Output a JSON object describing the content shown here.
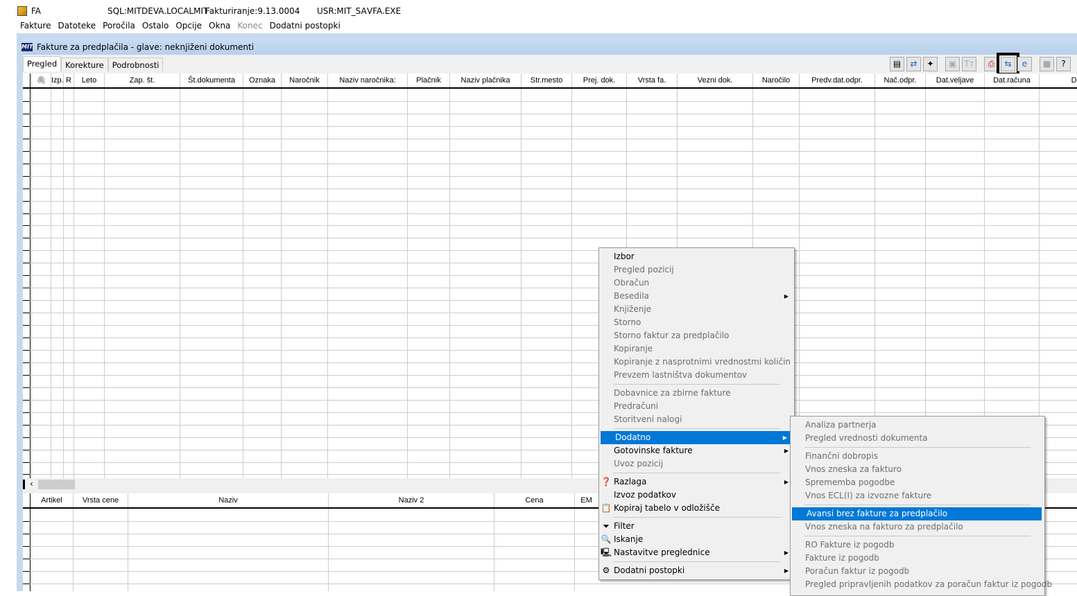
{
  "titlebar": {
    "app": "FA",
    "sql": "SQL:MITDEVA.LOCALMIT",
    "version": "Fakturiranje:9.13.0004",
    "user": "USR:MIT_SA",
    "exe": "VFA.EXE"
  },
  "menubar": [
    {
      "label": "Fakture",
      "enabled": true
    },
    {
      "label": "Datoteke",
      "enabled": true
    },
    {
      "label": "Poročila",
      "enabled": true
    },
    {
      "label": "Ostalo",
      "enabled": true
    },
    {
      "label": "Opcije",
      "enabled": true
    },
    {
      "label": "Okna",
      "enabled": true
    },
    {
      "label": "Konec",
      "enabled": false
    },
    {
      "label": "Dodatni postopki",
      "enabled": true
    }
  ],
  "window": {
    "logo": "MIT",
    "title": "Fakture za predplačila - glave: neknjiženi dokumenti"
  },
  "tabs": [
    {
      "label": "Pregled",
      "active": true
    },
    {
      "label": "Korekture"
    },
    {
      "label": "Podrobnosti"
    }
  ],
  "toolbar": [
    {
      "icon": "document-icon"
    },
    {
      "icon": "refresh-icon"
    },
    {
      "icon": "magic-wand-icon"
    },
    {
      "icon": "bag-icon",
      "disabled": true
    },
    {
      "icon": "font-icon",
      "disabled": true
    },
    {
      "icon": "pdf-icon"
    },
    {
      "icon": "transfer-icon",
      "highlighted": true
    },
    {
      "icon": "internet-explorer-icon"
    },
    {
      "icon": "gray-square-icon",
      "disabled": true
    },
    {
      "icon": "help-icon"
    }
  ],
  "main_grid": {
    "columns": [
      "",
      "Izp.",
      "R",
      "Leto",
      "Zap. št.",
      "Št.dokumenta",
      "Oznaka",
      "Naročnik",
      "Naziv naročnika:",
      "Plačnik",
      "Naziv plačnika",
      "Str.mesto",
      "Prej. dok.",
      "Vrsta fa.",
      "Vezni dok.",
      "Naročilo",
      "Predv.dat.odpr.",
      "Nač.odpr.",
      "Dat.veljave",
      "Dat.računa",
      "Davčni d"
    ]
  },
  "detail_grid": {
    "columns": [
      "Artikel",
      "Vrsta cene",
      "Naziv",
      "Naziv 2",
      "Cena",
      "EM"
    ]
  },
  "context_menu": {
    "items": [
      {
        "label": "Izbor",
        "enabled": true
      },
      {
        "label": "Pregled pozicij"
      },
      {
        "label": "Obračun"
      },
      {
        "label": "Besedila",
        "submenu": true
      },
      {
        "label": "Knjiženje"
      },
      {
        "label": "Storno"
      },
      {
        "label": "Storno faktur za predplačilo"
      },
      {
        "label": "Kopiranje"
      },
      {
        "label": "Kopiranje z nasprotnimi vrednostmi količin"
      },
      {
        "label": "Prevzem lastništva dokumentov"
      },
      {
        "separator": true
      },
      {
        "label": "Dobavnice za zbirne fakture"
      },
      {
        "label": "Predračuni"
      },
      {
        "label": "Storitveni nalogi"
      },
      {
        "separator": true
      },
      {
        "label": "Dodatno",
        "enabled": true,
        "submenu": true,
        "selected": true
      },
      {
        "label": "Gotovinske fakture",
        "enabled": true,
        "submenu": true
      },
      {
        "label": "Uvoz pozicij"
      },
      {
        "separator": true
      },
      {
        "label": "Razlaga",
        "enabled": true,
        "submenu": true,
        "icon": "help-book-icon"
      },
      {
        "label": "Izvoz podatkov",
        "enabled": true
      },
      {
        "label": "Kopiraj tabelo v odložišče",
        "enabled": true,
        "icon": "clipboard-icon"
      },
      {
        "separator": true
      },
      {
        "label": "Filter",
        "enabled": true,
        "icon": "filter-icon"
      },
      {
        "label": "Iskanje",
        "enabled": true,
        "icon": "search-icon"
      },
      {
        "label": "Nastavitve preglednice",
        "enabled": true,
        "submenu": true,
        "icon": "settings-monitor-icon"
      },
      {
        "separator": true
      },
      {
        "label": "Dodatni postopki",
        "enabled": true,
        "submenu": true,
        "icon": "gears-icon"
      }
    ]
  },
  "submenu": {
    "items": [
      {
        "label": "Analiza partnerja"
      },
      {
        "label": "Pregled vrednosti dokumenta"
      },
      {
        "separator": true
      },
      {
        "label": "Finančni dobropis"
      },
      {
        "label": "Vnos zneska za fakturo"
      },
      {
        "label": "Sprememba pogodbe"
      },
      {
        "label": "Vnos ECL(I) za izvozne fakture"
      },
      {
        "separator": true
      },
      {
        "label": "Avansi brez fakture za predplačilo",
        "selected": true
      },
      {
        "label": "Vnos zneska na fakturo za predplačilo"
      },
      {
        "separator": true
      },
      {
        "label": "RO Fakture iz pogodb"
      },
      {
        "label": "Fakture iz pogodb"
      },
      {
        "label": "Poračun faktur iz pogodb"
      },
      {
        "label": "Pregled pripravljenih podatkov za poračun faktur iz pogodb"
      }
    ]
  },
  "colors": {
    "highlight": "#0078d7",
    "mdi_background": "#c7d9ef"
  }
}
